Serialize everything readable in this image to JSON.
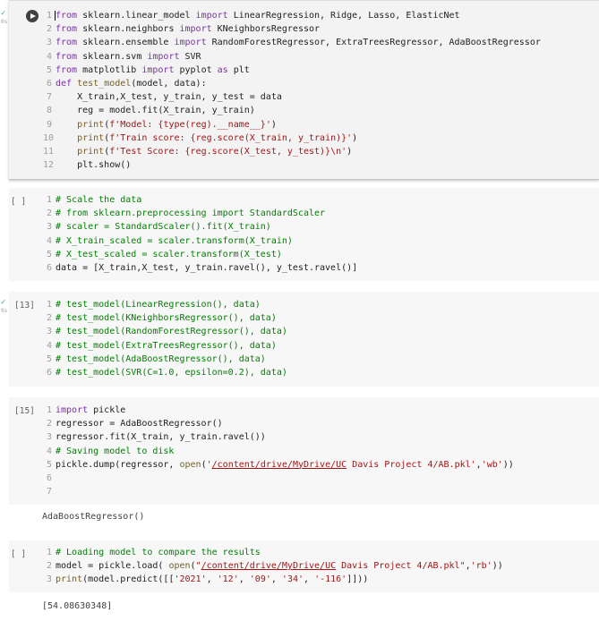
{
  "cells": [
    {
      "id": "cell-imports",
      "status": "✓",
      "duration": "0s",
      "lines": [
        "from sklearn.linear_model import LinearRegression, Ridge, Lasso, ElasticNet",
        "from sklearn.neighbors import KNeighborsRegressor",
        "from sklearn.ensemble import RandomForestRegressor, ExtraTreesRegressor, AdaBoostRegressor",
        "from sklearn.svm import SVR",
        "from matplotlib import pyplot as plt",
        "def test_model(model, data):",
        "    X_train,X_test, y_train, y_test = data",
        "    reg = model.fit(X_train, y_train)",
        "    print(f'Model: {type(reg).__name__}')",
        "    print(f'Train score: {reg.score(X_train, y_train)}')",
        "    print(f'Test Score: {reg.score(X_test, y_test)}\\n')",
        "    plt.show()"
      ]
    },
    {
      "id": "cell-scale",
      "exec_count": "[ ]",
      "lines": [
        "# Scale the data",
        "# from sklearn.preprocessing import StandardScaler",
        "# scaler = StandardScaler().fit(X_train)",
        "# X_train_scaled = scaler.transform(X_train)",
        "# X_test_scaled = scaler.transform(X_test)",
        "data = [X_train,X_test, y_train.ravel(), y_test.ravel()]"
      ]
    },
    {
      "id": "cell-test-models",
      "exec_count": "[13]",
      "status": "✓",
      "duration": "0s",
      "lines": [
        "# test_model(LinearRegression(), data)",
        "# test_model(KNeighborsRegressor(), data)",
        "# test_model(RandomForestRegressor(), data)",
        "# test_model(ExtraTreesRegressor(), data)",
        "# test_model(AdaBoostRegressor(), data)",
        "# test_model(SVR(C=1.0, epsilon=0.2), data)"
      ]
    },
    {
      "id": "cell-pickle-save",
      "exec_count": "[15]",
      "lines": [
        "import pickle",
        "regressor = AdaBoostRegressor()",
        "regressor.fit(X_train, y_train.ravel())",
        "# Saving model to disk",
        "pickle.dump(regressor, open('/content/drive/MyDrive/UC Davis Project 4/AB.pkl','wb'))",
        "",
        ""
      ],
      "output": "AdaBoostRegressor()"
    },
    {
      "id": "cell-pickle-load",
      "exec_count": "[ ]",
      "lines": [
        "# Loading model to compare the results",
        "model = pickle.load( open(\"/content/drive/MyDrive/UC Davis Project 4/AB.pkl\",'rb'))",
        "print(model.predict([['2021', '12', '09', '34', '-116']]))"
      ],
      "output": "[54.08630348]"
    }
  ],
  "colors": {
    "keyword": "#7b30a5",
    "comment": "#008000",
    "string": "#a31515",
    "number": "#098658",
    "cell_bg": "#f7f7f7",
    "success": "#5aa766"
  },
  "icons": {
    "run": "play-circle-icon",
    "status": "check-icon"
  }
}
